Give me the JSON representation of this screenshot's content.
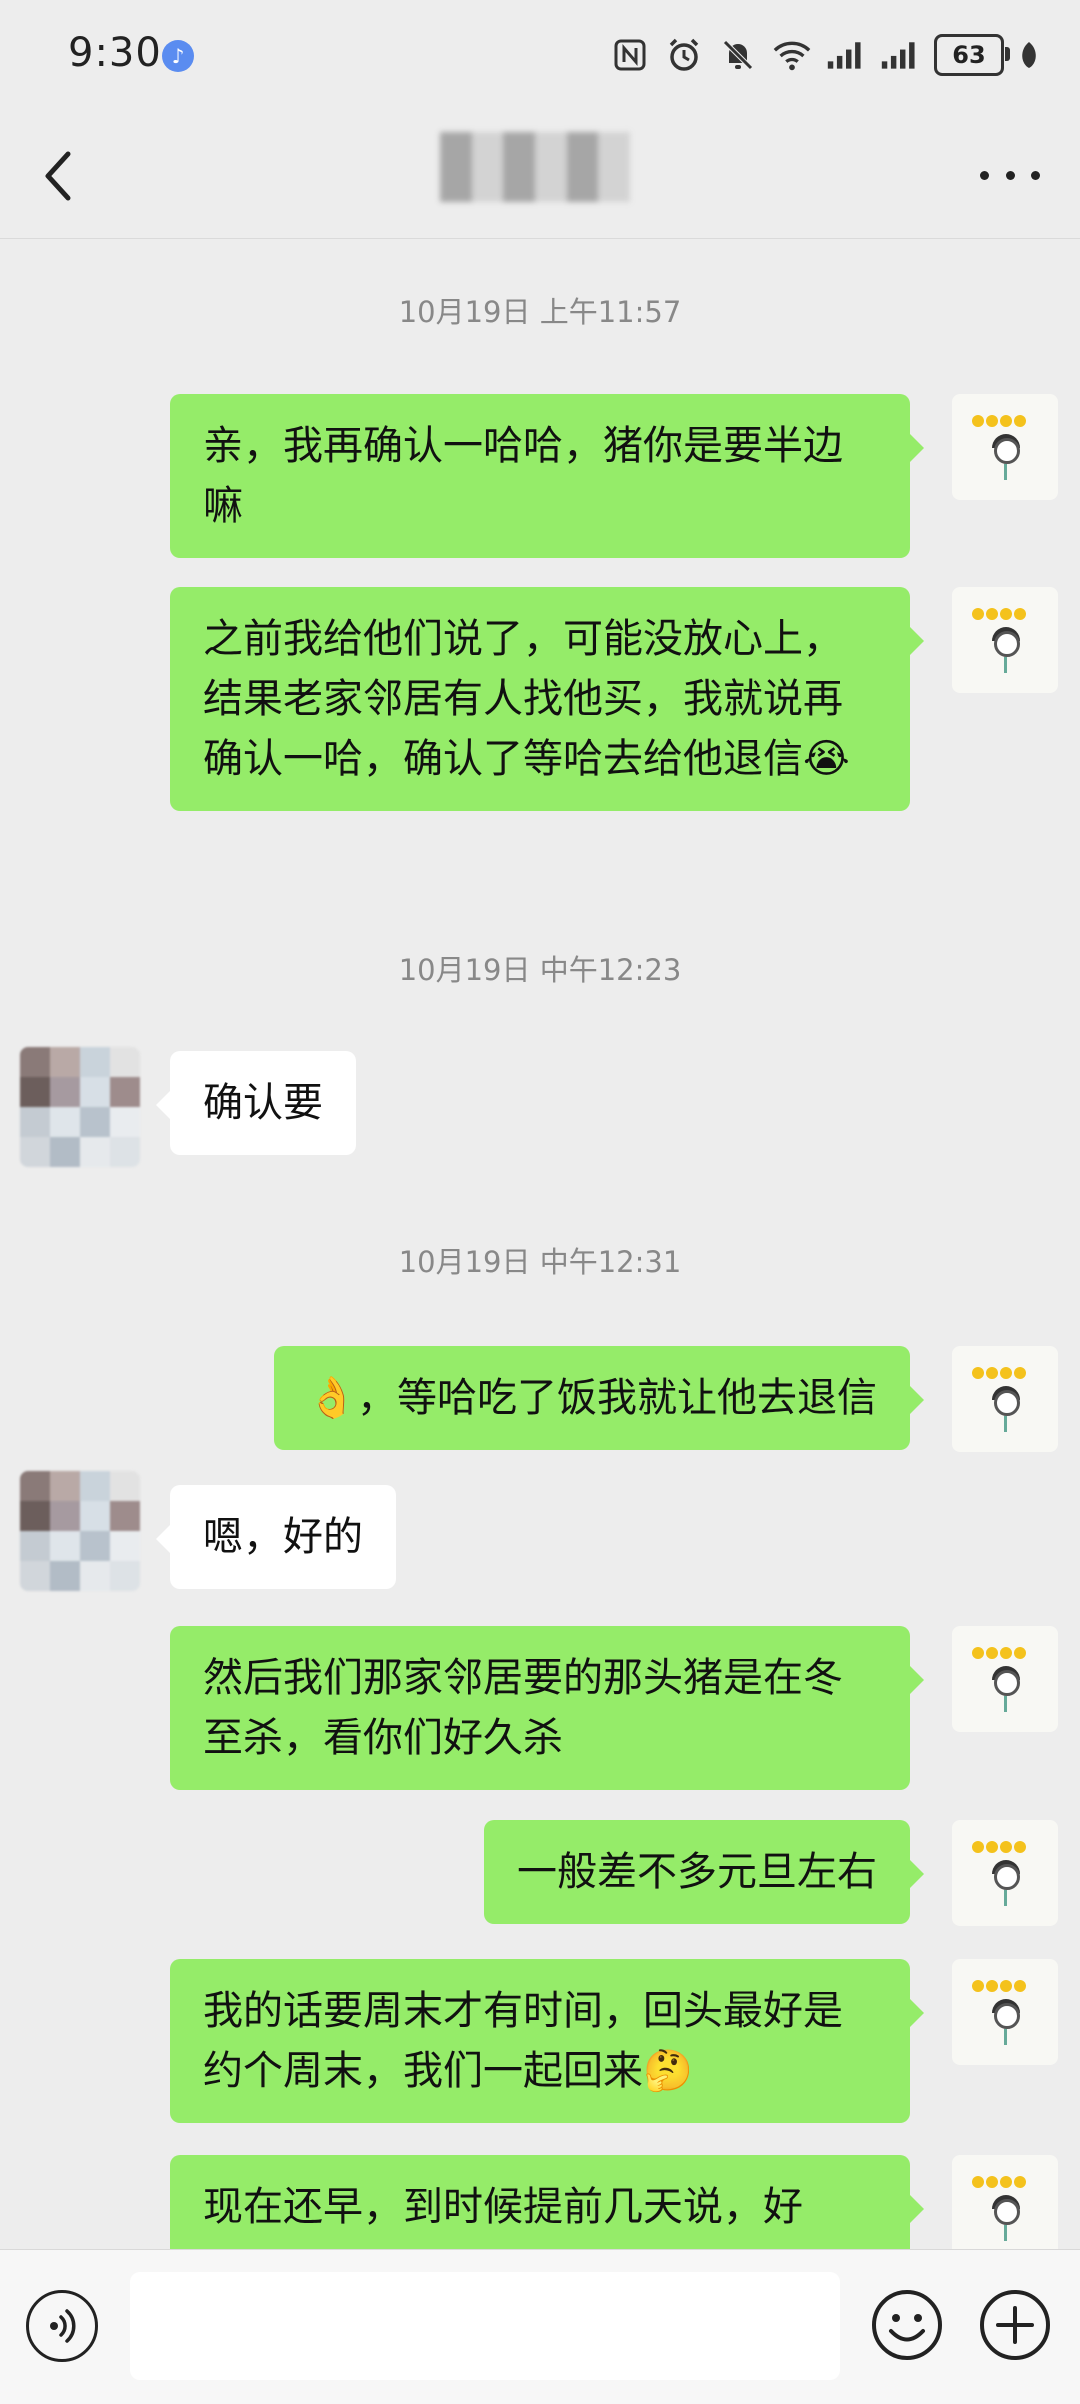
{
  "status_bar": {
    "time": "9:30",
    "battery": "63",
    "icons": [
      "nfc-icon",
      "alarm-icon",
      "mute-icon",
      "wifi-icon",
      "signal-icon",
      "signal-icon",
      "battery-icon",
      "leaf-icon"
    ]
  },
  "nav": {
    "title": "",
    "back_icon": "chevron-left-icon",
    "more_icon": "more-dots-icon"
  },
  "chat": {
    "timestamps": [
      "10月19日 上午11:57",
      "10月19日 中午12:23",
      "10月19日 中午12:31"
    ],
    "messages": [
      {
        "from": "me",
        "text": "亲，我再确认一哈哈，猪你是要半边嘛"
      },
      {
        "from": "me",
        "text": "之前我给他们说了，可能没放心上，结果老家邻居有人找他买，我就说再确认一哈，确认了等哈去给他退信",
        "emoji": "😭"
      },
      {
        "from": "them",
        "text": "确认要"
      },
      {
        "from": "me",
        "text": "，等哈吃了饭我就让他去退信",
        "emoji": "👌"
      },
      {
        "from": "them",
        "text": "嗯，好的"
      },
      {
        "from": "me",
        "text": "然后我们那家邻居要的那头猪是在冬至杀，看你们好久杀"
      },
      {
        "from": "me",
        "text": "一般差不多元旦左右"
      },
      {
        "from": "me",
        "text": "我的话要周末才有时间，回头最好是约个周末，我们一起回来",
        "emoji": "🤔"
      },
      {
        "from": "me",
        "text": "现在还早，到时候提前几天说，好"
      }
    ]
  },
  "input_bar": {
    "voice_icon": "voice-icon",
    "emoji_icon": "emoji-icon",
    "plus_icon": "plus-icon",
    "value": ""
  },
  "colors": {
    "background": "#ededed",
    "my_bubble": "#95ec69",
    "their_bubble": "#ffffff",
    "timestamp": "#888888"
  }
}
